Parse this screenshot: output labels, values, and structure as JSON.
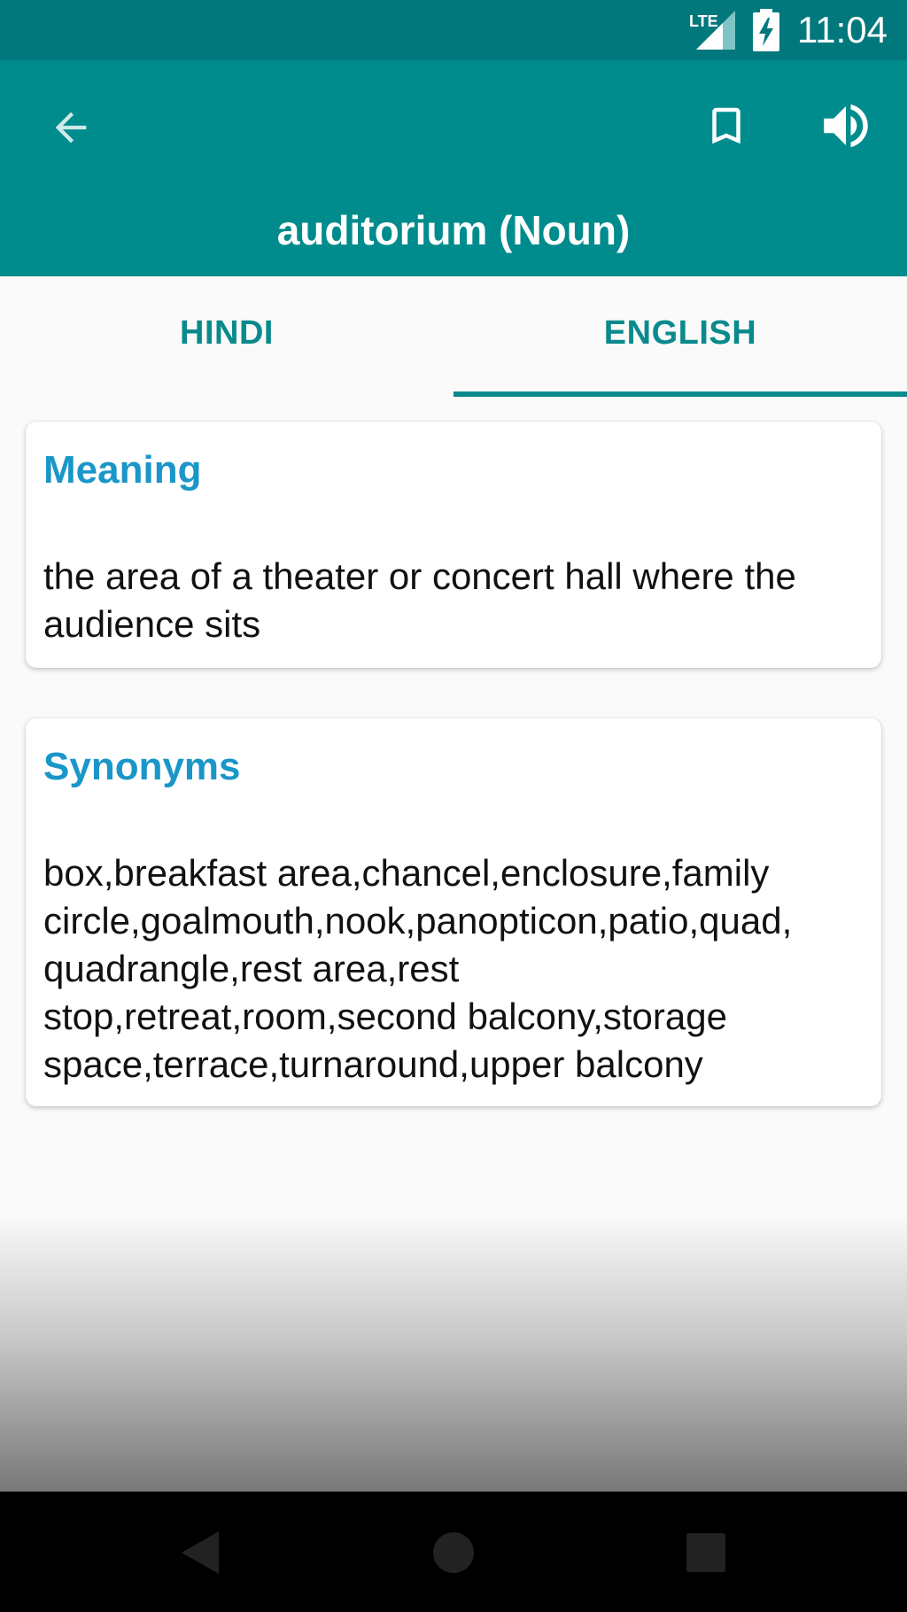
{
  "status_bar": {
    "time": "11:04",
    "network": "LTE",
    "icons": [
      "lte-signal-icon",
      "battery-charging-icon"
    ]
  },
  "app_bar": {
    "title": "auditorium (Noun)",
    "icons": [
      "back-arrow-icon",
      "bookmark-icon",
      "speaker-icon"
    ],
    "background_color": "#008b8d"
  },
  "tabs": [
    {
      "label": "HINDI",
      "selected": false
    },
    {
      "label": "ENGLISH",
      "selected": true
    }
  ],
  "cards": {
    "meaning": {
      "heading": "Meaning",
      "text": "the area of a theater or concert hall where the audience sits"
    },
    "synonyms": {
      "heading": "Synonyms",
      "text": "box,breakfast area,chancel,enclosure,family circle,goalmouth,nook,panopticon,patio,quad, quadrangle,rest area,rest stop,retreat,room,second balcony,storage space,terrace,turnaround,upper balcony"
    }
  },
  "nav_bar": {
    "icons": [
      "nav-back-icon",
      "nav-home-icon",
      "nav-recents-icon"
    ]
  },
  "colors": {
    "accent": "#0a8a8c",
    "heading": "#1a96c8",
    "status_bar": "#00787c"
  }
}
